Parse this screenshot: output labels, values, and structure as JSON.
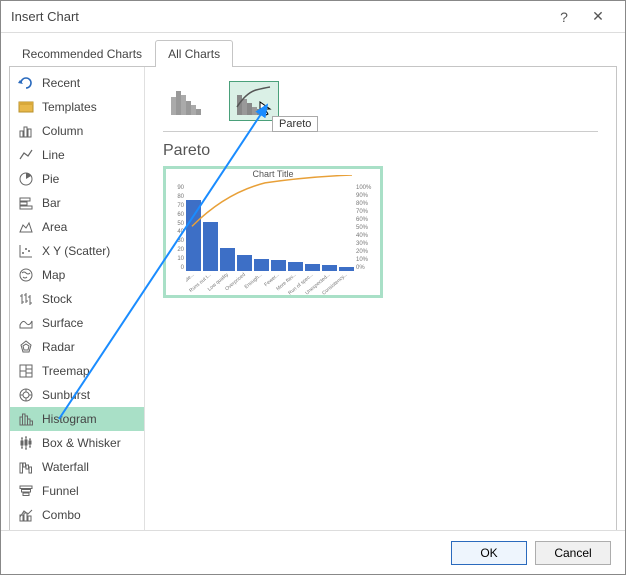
{
  "window": {
    "title": "Insert Chart",
    "help": "?",
    "close": "✕"
  },
  "tabs": {
    "recommended": "Recommended Charts",
    "all": "All Charts"
  },
  "sidebar": {
    "items": [
      {
        "label": "Recent"
      },
      {
        "label": "Templates"
      },
      {
        "label": "Column"
      },
      {
        "label": "Line"
      },
      {
        "label": "Pie"
      },
      {
        "label": "Bar"
      },
      {
        "label": "Area"
      },
      {
        "label": "X Y (Scatter)"
      },
      {
        "label": "Map"
      },
      {
        "label": "Stock"
      },
      {
        "label": "Surface"
      },
      {
        "label": "Radar"
      },
      {
        "label": "Treemap"
      },
      {
        "label": "Sunburst"
      },
      {
        "label": "Histogram"
      },
      {
        "label": "Box & Whisker"
      },
      {
        "label": "Waterfall"
      },
      {
        "label": "Funnel"
      },
      {
        "label": "Combo"
      }
    ]
  },
  "main": {
    "subtype_tooltip": "Pareto",
    "subtype_title": "Pareto",
    "preview_title": "Chart Title",
    "y_ticks": [
      "90",
      "80",
      "70",
      "60",
      "50",
      "40",
      "30",
      "20",
      "10",
      "0"
    ],
    "y2_ticks": [
      "100%",
      "90%",
      "80%",
      "70%",
      "60%",
      "50%",
      "40%",
      "30%",
      "20%",
      "10%",
      "0%"
    ]
  },
  "chart_data": {
    "type": "bar",
    "title": "Chart Title",
    "categories": [
      "Doesn't taste...",
      "Runs out t...",
      "Low quality",
      "Overpriced",
      "Enough...",
      "Fewer...",
      "More flav...",
      "Run of spec...",
      "Unexpected...",
      "Consistency..."
    ],
    "values": [
      80,
      55,
      26,
      18,
      14,
      12,
      10,
      8,
      7,
      5
    ],
    "ylim": [
      0,
      90
    ],
    "y2lim": [
      0,
      100
    ],
    "ylabel": "",
    "xlabel": ""
  },
  "buttons": {
    "ok": "OK",
    "cancel": "Cancel"
  }
}
